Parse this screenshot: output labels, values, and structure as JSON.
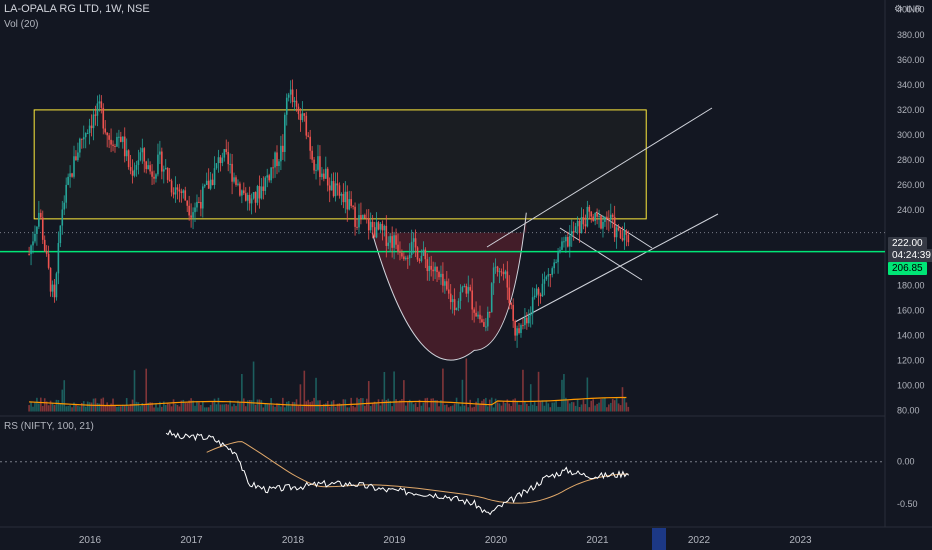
{
  "header": {
    "symbol_line": "LA-OPALA RG LTD, 1W, NSE",
    "volume_label": "Vol (20)",
    "currency": "INR",
    "settings_icon": "gear-icon"
  },
  "indicator": {
    "label": "RS (NIFTY, 100, 21)",
    "ticks": [
      "0.00",
      "-0.50"
    ]
  },
  "price_tags": {
    "last_price": "222.00",
    "countdown": "04:24:39",
    "support_price": "206.85"
  },
  "colors": {
    "background": "#131722",
    "up": "#26a69a",
    "down": "#ef5350",
    "rectangle": "#ffeb3b",
    "support": "#00e676",
    "volume_ma": "#ff9800",
    "rs_line": "#ffffff",
    "rs_ma": "#e0a86a",
    "cup": "#f23645"
  },
  "chart_data": {
    "type": "candlestick",
    "x_axis": {
      "tick_labels": [
        "2016",
        "2017",
        "2018",
        "2019",
        "2020",
        "2021",
        "2022",
        "2023"
      ]
    },
    "y_axis": {
      "tick_labels": [
        "400.00",
        "380.00",
        "360.00",
        "340.00",
        "320.00",
        "300.00",
        "280.00",
        "260.00",
        "240.00",
        "200.00",
        "180.00",
        "160.00",
        "140.00",
        "120.00",
        "100.00",
        "80.00"
      ],
      "range": [
        78,
        410
      ]
    },
    "price_series": [
      [
        2015.4,
        205
      ],
      [
        2015.5,
        240
      ],
      [
        2015.58,
        195
      ],
      [
        2015.65,
        165
      ],
      [
        2015.72,
        240
      ],
      [
        2015.8,
        265
      ],
      [
        2015.9,
        295
      ],
      [
        2016.0,
        310
      ],
      [
        2016.1,
        320
      ],
      [
        2016.2,
        295
      ],
      [
        2016.3,
        300
      ],
      [
        2016.4,
        270
      ],
      [
        2016.5,
        285
      ],
      [
        2016.6,
        270
      ],
      [
        2016.7,
        280
      ],
      [
        2016.8,
        260
      ],
      [
        2016.9,
        255
      ],
      [
        2017.0,
        240
      ],
      [
        2017.1,
        250
      ],
      [
        2017.2,
        265
      ],
      [
        2017.3,
        285
      ],
      [
        2017.4,
        270
      ],
      [
        2017.5,
        255
      ],
      [
        2017.6,
        245
      ],
      [
        2017.7,
        260
      ],
      [
        2017.8,
        275
      ],
      [
        2017.9,
        290
      ],
      [
        2017.95,
        340
      ],
      [
        2018.0,
        325
      ],
      [
        2018.05,
        315
      ],
      [
        2018.12,
        310
      ],
      [
        2018.2,
        280
      ],
      [
        2018.3,
        270
      ],
      [
        2018.4,
        255
      ],
      [
        2018.5,
        250
      ],
      [
        2018.6,
        235
      ],
      [
        2018.7,
        230
      ],
      [
        2018.8,
        225
      ],
      [
        2018.9,
        220
      ],
      [
        2019.0,
        215
      ],
      [
        2019.1,
        208
      ],
      [
        2019.2,
        210
      ],
      [
        2019.3,
        200
      ],
      [
        2019.4,
        190
      ],
      [
        2019.5,
        175
      ],
      [
        2019.6,
        165
      ],
      [
        2019.7,
        180
      ],
      [
        2019.8,
        160
      ],
      [
        2019.9,
        145
      ],
      [
        2020.0,
        200
      ],
      [
        2020.1,
        185
      ],
      [
        2020.2,
        140
      ],
      [
        2020.3,
        155
      ],
      [
        2020.4,
        175
      ],
      [
        2020.5,
        185
      ],
      [
        2020.6,
        200
      ],
      [
        2020.7,
        215
      ],
      [
        2020.8,
        225
      ],
      [
        2020.9,
        235
      ],
      [
        2021.0,
        230
      ],
      [
        2021.1,
        235
      ],
      [
        2021.2,
        220
      ],
      [
        2021.3,
        215
      ],
      [
        2021.31,
        222
      ]
    ],
    "last_price": 222.0,
    "support_level": 206.85,
    "rectangle": {
      "x": [
        2015.45,
        2021.48
      ],
      "y": [
        233,
        320
      ]
    },
    "cup_bottom": 128,
    "volume_ma_level": 88,
    "rs_series": [
      [
        2016.75,
        0.35
      ],
      [
        2016.9,
        0.28
      ],
      [
        2017.0,
        0.3
      ],
      [
        2017.2,
        0.28
      ],
      [
        2017.45,
        0.1
      ],
      [
        2017.55,
        -0.25
      ],
      [
        2017.75,
        -0.33
      ],
      [
        2018.0,
        -0.3
      ],
      [
        2018.3,
        -0.26
      ],
      [
        2018.6,
        -0.26
      ],
      [
        2018.9,
        -0.33
      ],
      [
        2019.2,
        -0.36
      ],
      [
        2019.5,
        -0.4
      ],
      [
        2019.8,
        -0.5
      ],
      [
        2019.92,
        -0.62
      ],
      [
        2020.05,
        -0.52
      ],
      [
        2020.3,
        -0.35
      ],
      [
        2020.5,
        -0.18
      ],
      [
        2020.7,
        -0.1
      ],
      [
        2020.85,
        -0.15
      ],
      [
        2021.0,
        -0.17
      ],
      [
        2021.2,
        -0.15
      ],
      [
        2021.32,
        -0.12
      ]
    ],
    "rs_range": [
      -0.65,
      0.42
    ]
  }
}
